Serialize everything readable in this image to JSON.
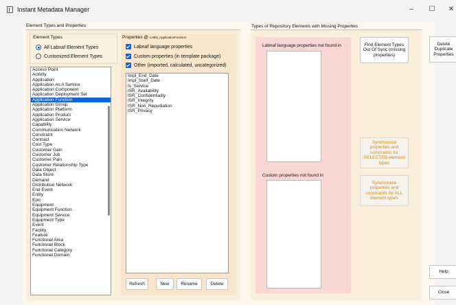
{
  "window": {
    "title": "Instant Metadata Manager",
    "minimize_label": "–",
    "maximize_label": "☐",
    "close_label": "✕"
  },
  "element_types_group": {
    "label": "Element Types and Properties",
    "subgroup_label": "Element Types",
    "radio_all_label": "All Labnaf Element Types",
    "radio_custom_label": "Customized Element Types",
    "selected_radio": "all",
    "items": [
      "Access Point",
      "Activity",
      "Application",
      "Application As A Service",
      "Application Component",
      "Application Deployment Set",
      "Application Function",
      "Application Group",
      "Application Platform",
      "Application Product",
      "Application Service",
      "Capability",
      "Communication Network",
      "Constraint",
      "Contract",
      "Cost Type",
      "Customer Gain",
      "Customer Job",
      "Customer Pain",
      "Customer Relationship Type",
      "Data Object",
      "Data Store",
      "Demand",
      "Distribution Network",
      "End Event",
      "Entity",
      "Epic",
      "Equipment",
      "Equipment Function",
      "Equipment Service",
      "Equipment Type",
      "Event",
      "Facility",
      "Feature",
      "Functional Area",
      "Functional Block",
      "Functional Category",
      "Functional Domain"
    ],
    "selected_item": "Application Function"
  },
  "properties_group": {
    "label": "Properties @",
    "context": "LABN_ApplicationFunction",
    "check_labnaf_label": "Labnaf language properties",
    "check_custom_label": "Custom properties (in template package)",
    "check_other_label": "Other (imported, calculated, uncategorized)",
    "items": [
      "Impl_End_Date",
      "Impl_Start_Date",
      "Is_Service",
      "ISR_Availability",
      "ISR_Confidentiality",
      "ISR_Integrity",
      "ISR_Non_Repudiation",
      "ISR_Privacy"
    ],
    "buttons": {
      "refresh": "Refresh",
      "new": "New",
      "rename": "Rename",
      "delete": "Delete"
    }
  },
  "missing_group": {
    "label": "Types of Repository Elements with Missing Properties",
    "labnaf_not_found_label": "Labnaf language properties not found in",
    "custom_not_found_label": "Custom properties not found in",
    "find_out_of_sync_label": "Find Element Types Out Of Sync (missing properties)",
    "sync_selected_label": "Synchronize properties and constraints for SELECTED element types",
    "sync_all_label": "Synchronize properties and constraints for ALL element types"
  },
  "side_buttons": {
    "delete_duplicate": "Delete Duplicate Properties",
    "help": "Help",
    "close": "Close"
  },
  "colors": {
    "accent": "#0a64d8",
    "panel_bg": "#fbefdc",
    "missing_bg": "#f9d8d4",
    "disabled_text": "#d08a1a"
  }
}
